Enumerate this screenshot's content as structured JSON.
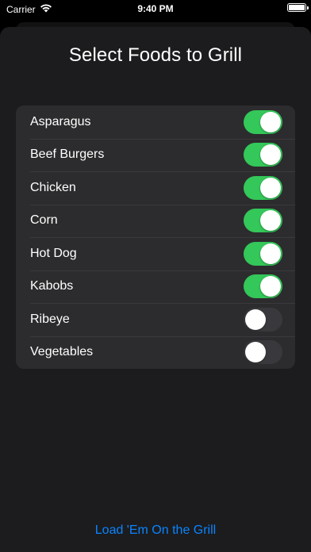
{
  "status_bar": {
    "carrier": "Carrier",
    "time": "9:40 PM",
    "battery_level": 1.0
  },
  "sheet": {
    "title": "Select Foods to Grill"
  },
  "foods": [
    {
      "label": "Asparagus",
      "on": true
    },
    {
      "label": "Beef Burgers",
      "on": true
    },
    {
      "label": "Chicken",
      "on": true
    },
    {
      "label": "Corn",
      "on": true
    },
    {
      "label": "Hot Dog",
      "on": true
    },
    {
      "label": "Kabobs",
      "on": true
    },
    {
      "label": "Ribeye",
      "on": false
    },
    {
      "label": "Vegetables",
      "on": false
    }
  ],
  "actions": {
    "load_label": "Load 'Em On the Grill"
  },
  "colors": {
    "toggle_on": "#34c759",
    "toggle_off": "#39393d",
    "accent": "#0a84ff",
    "sheet_background": "#1c1c1e",
    "list_background": "#2c2c2e"
  },
  "icons": {
    "wifi": "wifi-icon",
    "battery": "battery-icon"
  }
}
